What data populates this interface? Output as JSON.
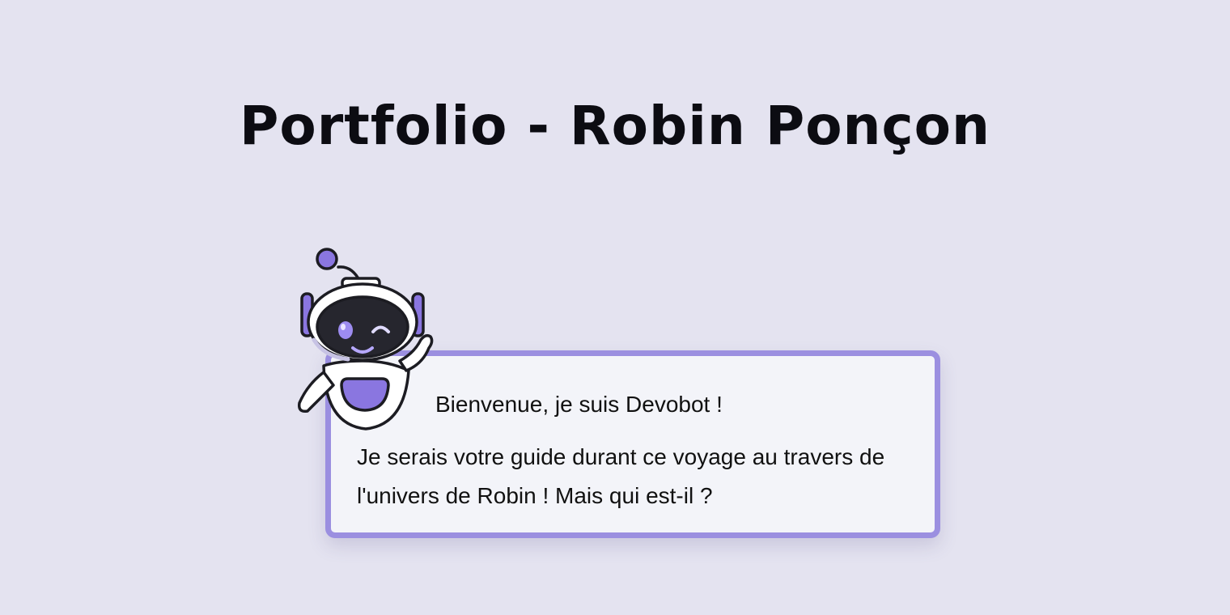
{
  "header": {
    "title": "Portfolio - Robin Ponçon"
  },
  "dialog": {
    "greeting": "Bienvenue, je suis Devobot !",
    "message": "Je serais votre guide durant ce voyage au travers de l'univers de Robin ! Mais qui est-il ?"
  },
  "mascot": {
    "icon": "robot-mascot-icon",
    "accent_color": "#8a76e0"
  },
  "colors": {
    "background": "#e4e3f0",
    "card_border": "#9b8fe0",
    "card_background": "#f3f4f9",
    "text": "#111111"
  }
}
